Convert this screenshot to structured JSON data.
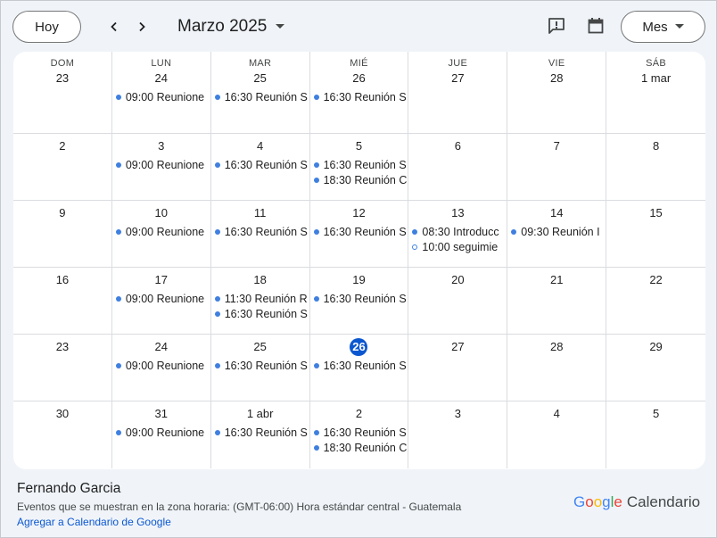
{
  "toolbar": {
    "today_label": "Hoy",
    "month_title": "Marzo 2025",
    "view_label": "Mes",
    "icons": [
      "chevron-left-icon",
      "chevron-right-icon",
      "dropdown-caret-icon",
      "feedback-icon",
      "calendar-icon"
    ]
  },
  "weekdays": [
    "DOM",
    "LUN",
    "MAR",
    "MIÉ",
    "JUE",
    "VIE",
    "SÁB"
  ],
  "weeks": [
    [
      {
        "day": "23",
        "events": []
      },
      {
        "day": "24",
        "events": [
          {
            "text": "09:00 Reunione"
          }
        ]
      },
      {
        "day": "25",
        "events": [
          {
            "text": "16:30 Reunión S"
          }
        ]
      },
      {
        "day": "26",
        "events": [
          {
            "text": "16:30 Reunión S"
          }
        ]
      },
      {
        "day": "27",
        "events": []
      },
      {
        "day": "28",
        "events": []
      },
      {
        "day": "1 mar",
        "events": []
      }
    ],
    [
      {
        "day": "2",
        "events": []
      },
      {
        "day": "3",
        "events": [
          {
            "text": "09:00 Reunione"
          }
        ]
      },
      {
        "day": "4",
        "events": [
          {
            "text": "16:30 Reunión S"
          }
        ]
      },
      {
        "day": "5",
        "events": [
          {
            "text": "16:30 Reunión S"
          },
          {
            "text": "18:30 Reunión C"
          }
        ]
      },
      {
        "day": "6",
        "events": []
      },
      {
        "day": "7",
        "events": []
      },
      {
        "day": "8",
        "events": []
      }
    ],
    [
      {
        "day": "9",
        "events": []
      },
      {
        "day": "10",
        "events": [
          {
            "text": "09:00 Reunione"
          }
        ]
      },
      {
        "day": "11",
        "events": [
          {
            "text": "16:30 Reunión S"
          }
        ]
      },
      {
        "day": "12",
        "events": [
          {
            "text": "16:30 Reunión S"
          }
        ]
      },
      {
        "day": "13",
        "events": [
          {
            "text": "08:30 Introducc"
          },
          {
            "text": "10:00 seguimie",
            "outline": true
          }
        ]
      },
      {
        "day": "14",
        "events": [
          {
            "text": "09:30 Reunión I"
          }
        ]
      },
      {
        "day": "15",
        "events": []
      }
    ],
    [
      {
        "day": "16",
        "events": []
      },
      {
        "day": "17",
        "events": [
          {
            "text": "09:00 Reunione"
          }
        ]
      },
      {
        "day": "18",
        "events": [
          {
            "text": "11:30 Reunión R"
          },
          {
            "text": "16:30 Reunión S"
          }
        ]
      },
      {
        "day": "19",
        "events": [
          {
            "text": "16:30 Reunión S"
          }
        ]
      },
      {
        "day": "20",
        "events": []
      },
      {
        "day": "21",
        "events": []
      },
      {
        "day": "22",
        "events": []
      }
    ],
    [
      {
        "day": "23",
        "events": []
      },
      {
        "day": "24",
        "events": [
          {
            "text": "09:00 Reunione"
          }
        ]
      },
      {
        "day": "25",
        "events": [
          {
            "text": "16:30 Reunión S"
          }
        ]
      },
      {
        "day": "26",
        "today": true,
        "events": [
          {
            "text": "16:30 Reunión S"
          }
        ]
      },
      {
        "day": "27",
        "events": []
      },
      {
        "day": "28",
        "events": []
      },
      {
        "day": "29",
        "events": []
      }
    ],
    [
      {
        "day": "30",
        "events": []
      },
      {
        "day": "31",
        "events": [
          {
            "text": "09:00 Reunione"
          }
        ]
      },
      {
        "day": "1 abr",
        "events": [
          {
            "text": "16:30 Reunión S"
          }
        ]
      },
      {
        "day": "2",
        "events": [
          {
            "text": "16:30 Reunión S"
          },
          {
            "text": "18:30 Reunión C"
          }
        ]
      },
      {
        "day": "3",
        "events": []
      },
      {
        "day": "4",
        "events": []
      },
      {
        "day": "5",
        "events": []
      }
    ]
  ],
  "footer": {
    "owner_name": "Fernando Garcia",
    "timezone_text": "Eventos que se muestran en la zona horaria: (GMT-06:00) Hora estándar central - Guatemala",
    "add_link": "Agregar a Calendario de Google",
    "brand_google": "Google",
    "brand_product": "Calendario"
  },
  "colors": {
    "accent": "#0b57d0",
    "event_dot": "#3f7fe0",
    "background": "#f0f4f9"
  }
}
